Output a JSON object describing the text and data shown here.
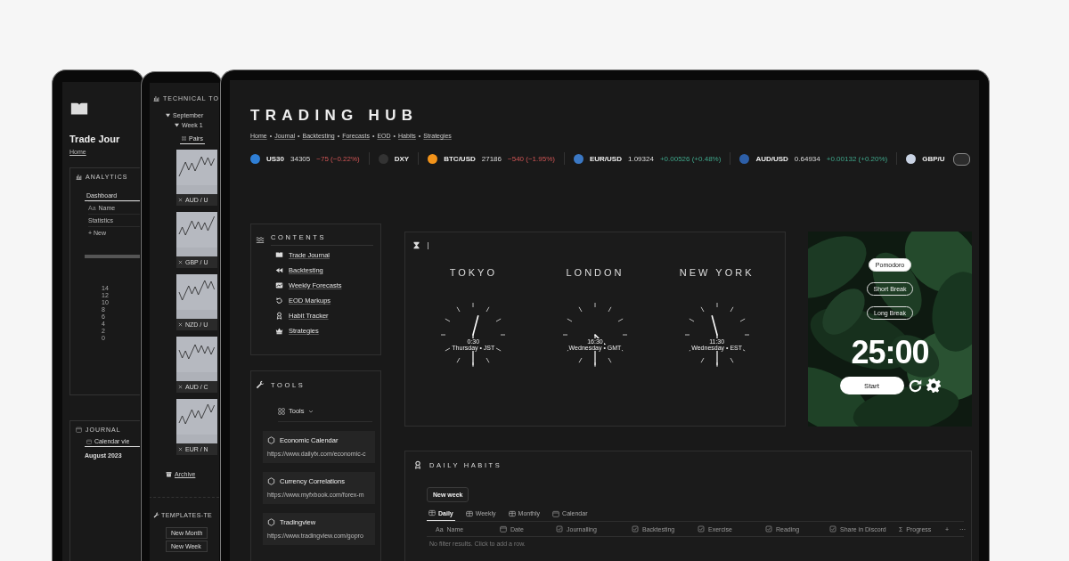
{
  "journal_screen": {
    "title": "Trade Jour",
    "breadcrumb": "Home",
    "analytics": {
      "heading": "ANALYTICS",
      "tab": {
        "label": "Dashboard",
        "selected": true
      },
      "rows": [
        {
          "icon_text": "Aa",
          "label": "Name"
        },
        {
          "label": "Statistics"
        }
      ],
      "new_label": "+ New",
      "y_ticks": [
        "14",
        "12",
        "10",
        "8",
        "6",
        "4",
        "2",
        "0"
      ]
    },
    "journal": {
      "heading": "JOURNAL",
      "tab": "Calendar vie",
      "month": "August 2023"
    }
  },
  "technical_screen": {
    "heading": "TECHNICAL TO",
    "tree": [
      {
        "label": "September",
        "expanded": true,
        "children": [
          {
            "label": "Week 1",
            "expanded": true
          }
        ]
      }
    ],
    "view_tab": {
      "label": "Pairs",
      "selected": true
    },
    "pairs": [
      {
        "label": "AUD / U"
      },
      {
        "label": "GBP / U"
      },
      {
        "label": "NZD / U"
      },
      {
        "label": "AUD / C"
      },
      {
        "label": "EUR / N"
      }
    ],
    "archive": "Archive",
    "templates": {
      "heading": "TEMPLATES-TE",
      "buttons": [
        "New Month",
        "New Week"
      ]
    }
  },
  "hub": {
    "title": "TRADING HUB",
    "separator": "•",
    "breadcrumb": [
      "Home",
      "Journal",
      "Backtesting",
      "Forecasts",
      "EOD",
      "Habits",
      "Strategies"
    ],
    "ticker": [
      {
        "symbol": "US30",
        "price": "34305",
        "change": "−75 (−0.22%)",
        "rising": false,
        "color": "#2f7fd6"
      },
      {
        "symbol": "DXY",
        "color": "#333333"
      },
      {
        "symbol": "BTC/USD",
        "price": "27186",
        "change": "−540 (−1.95%)",
        "rising": false,
        "color": "#f2931a"
      },
      {
        "symbol": "EUR/USD",
        "price": "1.09324",
        "change": "+0.00526 (+0.48%)",
        "rising": true,
        "color": "#3b78c4"
      },
      {
        "symbol": "AUD/USD",
        "price": "0.64934",
        "change": "+0.00132 (+0.20%)",
        "rising": true,
        "color": "#2d5fa8"
      },
      {
        "symbol": "GBP/U",
        "color": "#c9d3e4"
      }
    ],
    "contents": {
      "heading": "CONTENTS",
      "items": [
        {
          "label": "Trade Journal",
          "kind": "book"
        },
        {
          "label": "Backtesting",
          "kind": "rewind"
        },
        {
          "label": "Weekly Forecasts",
          "kind": "chart"
        },
        {
          "label": "EOD Markups",
          "kind": "undo"
        },
        {
          "label": "Habit Tracker",
          "kind": "award"
        },
        {
          "label": "Strategies",
          "kind": "crown"
        }
      ]
    },
    "tools": {
      "heading": "TOOLS",
      "view": "Tools",
      "cards": [
        {
          "title": "Economic Calendar",
          "url": "https://www.dailyfx.com/economic-c"
        },
        {
          "title": "Currency Correlations",
          "url": "https://www.myfxbook.com/forex-m"
        },
        {
          "title": "Tradingview",
          "url": "https://www.tradingview.com/gopro"
        }
      ]
    },
    "world_clock": {
      "cities": [
        {
          "name": "TOKYO",
          "time": "0:30",
          "day_zone": "Thursday • JST"
        },
        {
          "name": "LONDON",
          "time": "16:30",
          "day_zone": "Wednesday • GMT"
        },
        {
          "name": "NEW YORK",
          "time": "11:30",
          "day_zone": "Wednesday • EST"
        }
      ]
    },
    "pomodoro": {
      "modes": [
        {
          "label": "Pomodoro",
          "selected": true
        },
        {
          "label": "Short Break",
          "selected": false
        },
        {
          "label": "Long Break",
          "selected": false
        }
      ],
      "time": "25:00",
      "start": "Start"
    },
    "habits": {
      "heading": "DAILY HABITS",
      "new_button": "New week",
      "views": [
        {
          "label": "Daily",
          "kind": "table",
          "selected": true
        },
        {
          "label": "Weekly",
          "kind": "table",
          "selected": false
        },
        {
          "label": "Monthly",
          "kind": "table",
          "selected": false
        },
        {
          "label": "Calendar",
          "kind": "calendar",
          "selected": false
        }
      ],
      "columns": [
        {
          "label": "Name",
          "kind": "title",
          "icon_text": "Aa"
        },
        {
          "label": "Date",
          "kind": "date"
        },
        {
          "label": "Journalling",
          "kind": "checkbox"
        },
        {
          "label": "Backtesting",
          "kind": "checkbox"
        },
        {
          "label": "Exercise",
          "kind": "checkbox"
        },
        {
          "label": "Reading",
          "kind": "checkbox"
        },
        {
          "label": "Share in Discord",
          "kind": "checkbox"
        },
        {
          "label": "Progress",
          "kind": "formula",
          "icon_text": "Σ"
        }
      ],
      "add": "+",
      "more": "···",
      "empty": "No filter results. Click to add a row."
    }
  }
}
